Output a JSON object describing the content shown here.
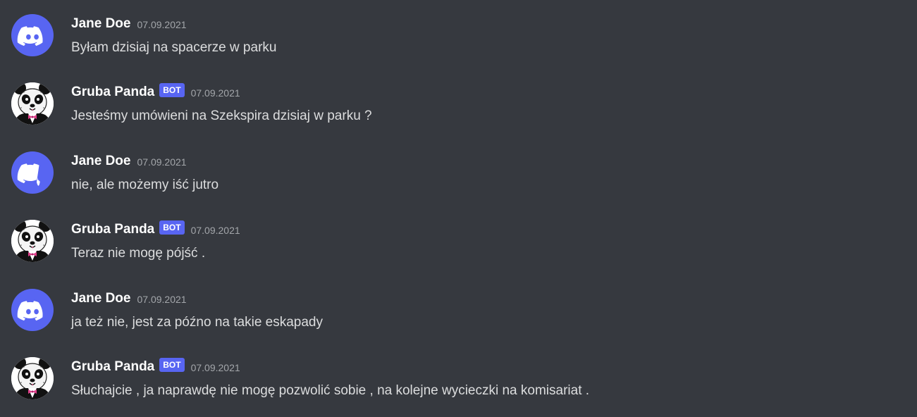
{
  "messages": [
    {
      "author": "Jane Doe",
      "is_bot": false,
      "avatar": "discord-logo-icon",
      "timestamp": "07.09.2021",
      "text": "Byłam dzisiaj na spacerze w parku"
    },
    {
      "author": "Gruba Panda",
      "is_bot": true,
      "bot_tag": "BOT",
      "avatar": "panda-avatar",
      "timestamp": "07.09.2021",
      "text": "Jesteśmy umówieni na Szekspira dzisiaj w parku ?"
    },
    {
      "author": "Jane Doe",
      "is_bot": false,
      "avatar": "discord-logo-icon",
      "timestamp": "07.09.2021",
      "text": "nie, ale możemy iść jutro"
    },
    {
      "author": "Gruba Panda",
      "is_bot": true,
      "bot_tag": "BOT",
      "avatar": "panda-avatar",
      "timestamp": "07.09.2021",
      "text": "Teraz nie mogę pójść ."
    },
    {
      "author": "Jane Doe",
      "is_bot": false,
      "avatar": "discord-logo-icon",
      "timestamp": "07.09.2021",
      "text": "ja też nie, jest za późno na takie eskapady"
    },
    {
      "author": "Gruba Panda",
      "is_bot": true,
      "bot_tag": "BOT",
      "avatar": "panda-avatar",
      "timestamp": "07.09.2021",
      "text": "Słuchajcie , ja naprawdę nie mogę pozwolić sobie , na kolejne wycieczki na komisariat ."
    }
  ],
  "colors": {
    "background": "#36393f",
    "discord_blurple": "#5865f2",
    "username": "#ffffff",
    "message_text": "#dcddde",
    "timestamp": "#a3a6aa"
  }
}
